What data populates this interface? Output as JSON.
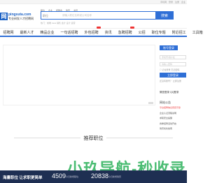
{
  "topbar": {
    "links": [
      "手机网",
      "登录",
      "注册",
      "企业"
    ]
  },
  "logo": {
    "mark": "网",
    "url": "pingsuta.com",
    "slogan": "专业研发人才招聘网"
  },
  "search": {
    "tabs": [
      "职位",
      "企业",
      "招聘会",
      "简历",
      "资讯"
    ],
    "category": "职位",
    "placeholder": "请输入职位名称或公司名称",
    "button": "搜索",
    "hot": "热门：前端  Java  销售  会计  设计  运营"
  },
  "nav": {
    "items": [
      "招聘网",
      "最新人才",
      "精品企业",
      "一句话招聘",
      "外包招聘",
      "资讯",
      "急聘招聘",
      "公招",
      "职位专题",
      "附近招工",
      "工具箱"
    ]
  },
  "side": {
    "login_tag": "账号登录",
    "user_placeholder": "手机号/用户名",
    "pwd_placeholder": "请输入密码",
    "options": "☐ 记住登录  忘记密码",
    "login_btn": "立即登录",
    "register": "还没有账号？ 立即注册",
    "wechat": "微信登录   QQ登录",
    "notice_title": "网站公告",
    "notices": [
      "平台招聘信息真实可靠",
      "企业认证流程说明",
      "求职安全提醒",
      "春季招聘活动开启",
      "简历优化指南"
    ]
  },
  "section": {
    "title": "推荐职位"
  },
  "footer": {
    "label": "海量职位 让求职更简单",
    "num1": "4509",
    "lbl1": "今日新增职位",
    "num2": "20838",
    "lbl2": "今日新增简历"
  },
  "watermark": "小玖导航-秒收录"
}
